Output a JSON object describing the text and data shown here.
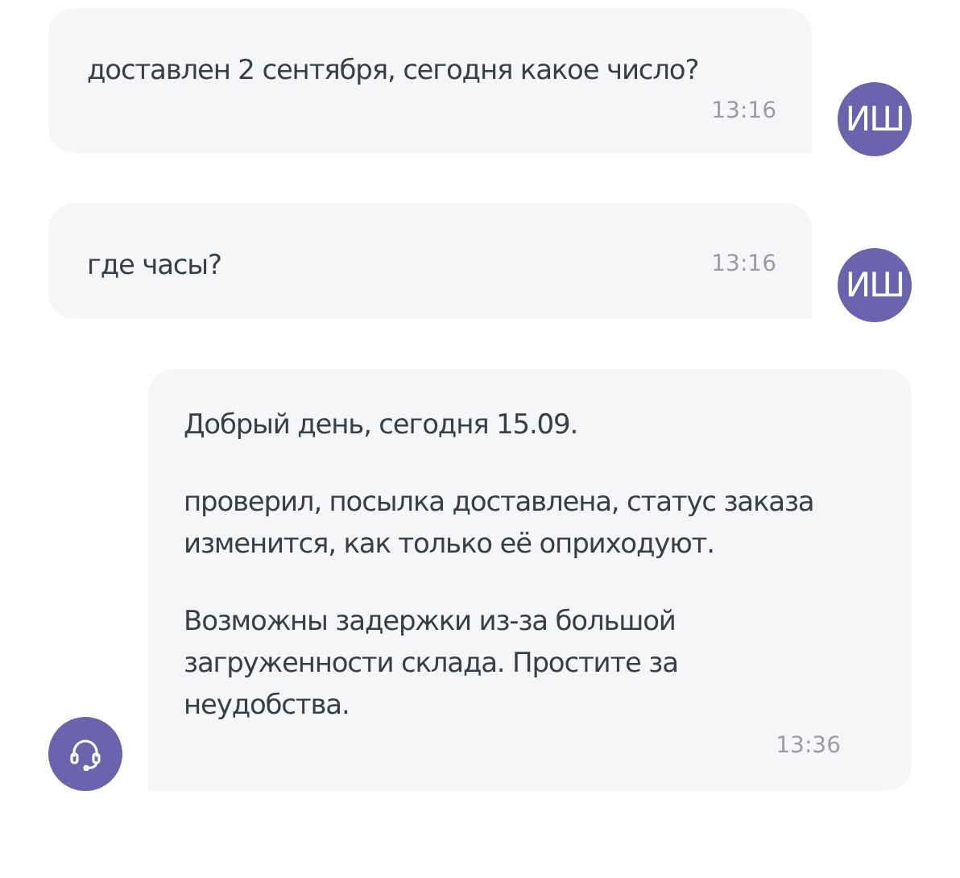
{
  "messages": [
    {
      "kind": "user",
      "avatar": "ИШ",
      "paragraphs": [
        "доставлен 2 сентября, сегодня какое число?"
      ],
      "time": "13:16",
      "time_inline": false
    },
    {
      "kind": "user",
      "avatar": "ИШ",
      "paragraphs": [
        "где часы?"
      ],
      "time": "13:16",
      "time_inline": true
    },
    {
      "kind": "agent",
      "paragraphs": [
        "Добрый день, сегодня 15.09.",
        "проверил, посылка доставлена, статус заказа изменится, как только её оприходуют.",
        "Возможны задержки из-за большой загруженности склада. Простите за неудобства."
      ],
      "time": "13:36",
      "time_inline": false
    }
  ]
}
